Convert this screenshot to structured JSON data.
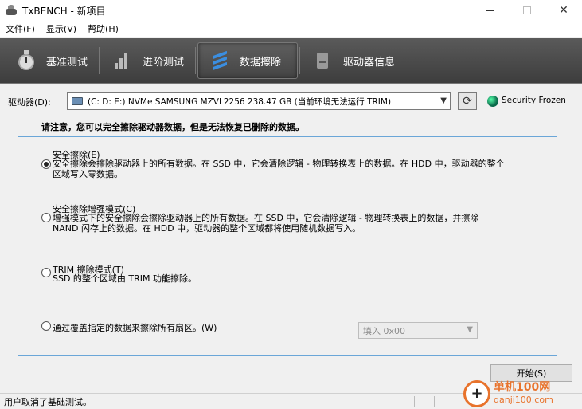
{
  "window": {
    "title": "TxBENCH - 新项目",
    "controls": {
      "minimize": "─",
      "maximize": "☐",
      "close": "✕"
    }
  },
  "menu": [
    "文件(F)",
    "显示(V)",
    "帮助(H)"
  ],
  "tabs": [
    {
      "label": "基准测试",
      "icon": "stopwatch-icon",
      "active": false
    },
    {
      "label": "进阶测试",
      "icon": "bar-chart-icon",
      "active": false
    },
    {
      "label": "数据擦除",
      "icon": "shredder-icon",
      "active": true
    },
    {
      "label": "驱动器信息",
      "icon": "drive-info-icon",
      "active": false
    }
  ],
  "drive": {
    "label": "驱动器(D):",
    "selected": "(C: D: E:) NVMe SAMSUNG MZVL2256  238.47 GB (当前环境无法运行 TRIM)",
    "security_status": "Security Frozen"
  },
  "notice": "请注意，您可以完全擦除驱动器数据，但是无法恢复已删除的数据。",
  "options": [
    {
      "title": "安全擦除(E)",
      "desc": [
        "安全擦除会擦除驱动器上的所有数据。在 SSD 中，它会清除逻辑 - 物理转换表上的数据。在 HDD 中，驱动器的整个",
        "区域写入零数据。"
      ],
      "checked": true
    },
    {
      "title": "安全擦除增强模式(C)",
      "desc": [
        "增强模式下的安全擦除会擦除驱动器上的所有数据。在 SSD 中，它会清除逻辑 - 物理转换表上的数据，并擦除",
        "NAND 闪存上的数据。在 HDD 中，驱动器的整个区域都将使用随机数据写入。"
      ],
      "checked": false
    },
    {
      "title": "TRIM 擦除模式(T)",
      "desc": [
        "SSD 的整个区域由 TRIM 功能擦除。"
      ],
      "checked": false
    },
    {
      "title": "通过覆盖指定的数据来擦除所有扇区。(W)",
      "desc": [],
      "checked": false
    }
  ],
  "fill_select": "填入 0x00",
  "start_button": "开始(S)",
  "status": "用户取消了基础测试。",
  "watermark": {
    "site_cn": "单机100网",
    "site_url": "danji100.com"
  }
}
